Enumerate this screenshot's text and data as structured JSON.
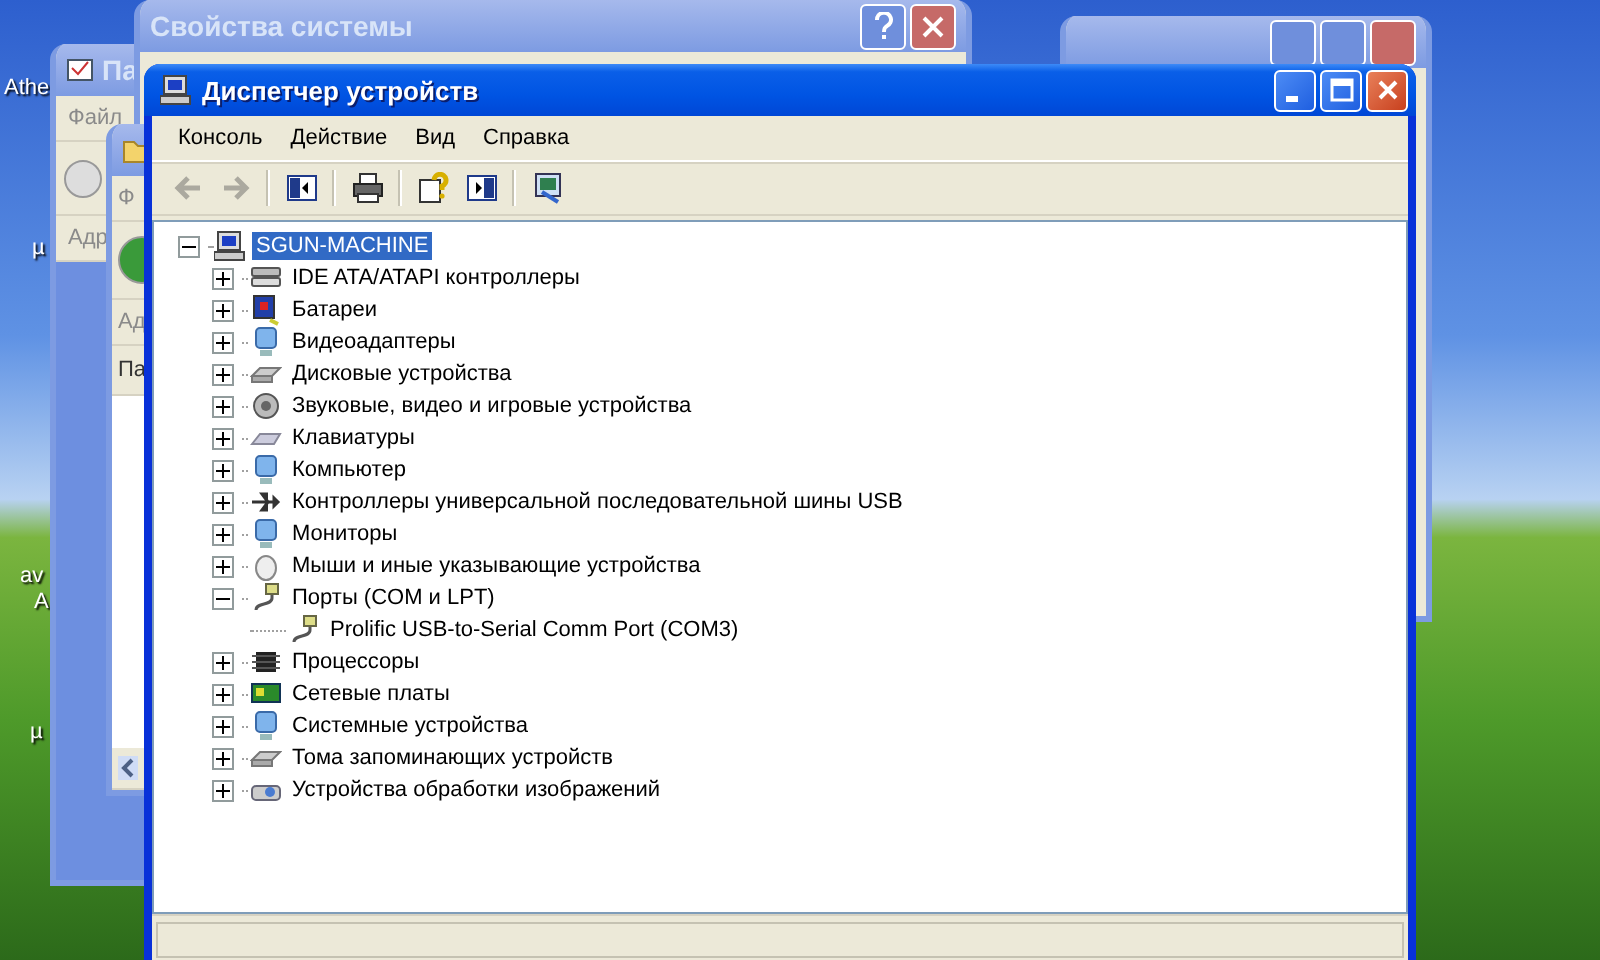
{
  "desktop_labels": [
    {
      "text": "Athe"
    },
    {
      "text": "µ"
    },
    {
      "text": "av"
    },
    {
      "text": "A"
    },
    {
      "text": "µ"
    }
  ],
  "background_windows": [
    {
      "kind": "explorer",
      "title": "Па",
      "menu_item": "Файл",
      "address_label": "Адр"
    },
    {
      "kind": "plain"
    },
    {
      "kind": "dialog",
      "title": "Свойства системы"
    },
    {
      "kind": "folder",
      "menu_item": "Ф",
      "address_label": "Ад",
      "column_header": "Па"
    }
  ],
  "window": {
    "title": "Диспетчер устройств",
    "active": true
  },
  "menu": [
    "Консоль",
    "Действие",
    "Вид",
    "Справка"
  ],
  "toolbar": [
    {
      "kind": "back",
      "disabled": true
    },
    {
      "kind": "forward",
      "disabled": true
    },
    {
      "kind": "separator"
    },
    {
      "kind": "console-tree",
      "disabled": false
    },
    {
      "kind": "separator"
    },
    {
      "kind": "print",
      "disabled": false
    },
    {
      "kind": "separator"
    },
    {
      "kind": "help",
      "disabled": false
    },
    {
      "kind": "properties",
      "disabled": false
    },
    {
      "kind": "separator"
    },
    {
      "kind": "scan",
      "disabled": false
    }
  ],
  "tree": {
    "label": "SGUN-MACHINE",
    "kind": "computer",
    "selected": true,
    "expanded": true,
    "children": [
      {
        "label": "IDE ATA/ATAPI контроллеры",
        "kind": "ide",
        "selected": false,
        "expanded": false
      },
      {
        "label": "Батареи",
        "kind": "battery",
        "selected": false,
        "expanded": false
      },
      {
        "label": "Видеоадаптеры",
        "kind": "display",
        "selected": false,
        "expanded": false
      },
      {
        "label": "Дисковые устройства",
        "kind": "disk",
        "selected": false,
        "expanded": false
      },
      {
        "label": "Звуковые, видео и игровые устройства",
        "kind": "sound",
        "selected": false,
        "expanded": false
      },
      {
        "label": "Клавиатуры",
        "kind": "keyboard",
        "selected": false,
        "expanded": false
      },
      {
        "label": "Компьютер",
        "kind": "display",
        "selected": false,
        "expanded": false
      },
      {
        "label": "Контроллеры универсальной последовательной шины USB",
        "kind": "usb",
        "selected": false,
        "expanded": false
      },
      {
        "label": "Мониторы",
        "kind": "display",
        "selected": false,
        "expanded": false
      },
      {
        "label": "Мыши и иные указывающие устройства",
        "kind": "mouse",
        "selected": false,
        "expanded": false
      },
      {
        "label": "Порты (COM и LPT)",
        "kind": "port",
        "selected": false,
        "expanded": true,
        "children": [
          {
            "label": "Prolific USB-to-Serial Comm Port (COM3)",
            "kind": "port",
            "selected": false
          }
        ]
      },
      {
        "label": "Процессоры",
        "kind": "cpu",
        "selected": false,
        "expanded": false
      },
      {
        "label": "Сетевые платы",
        "kind": "network",
        "selected": false,
        "expanded": false
      },
      {
        "label": "Системные устройства",
        "kind": "display",
        "selected": false,
        "expanded": false
      },
      {
        "label": "Тома запоминающих устройств",
        "kind": "disk",
        "selected": false,
        "expanded": false
      },
      {
        "label": "Устройства обработки изображений",
        "kind": "camera",
        "selected": false,
        "expanded": false
      }
    ]
  }
}
